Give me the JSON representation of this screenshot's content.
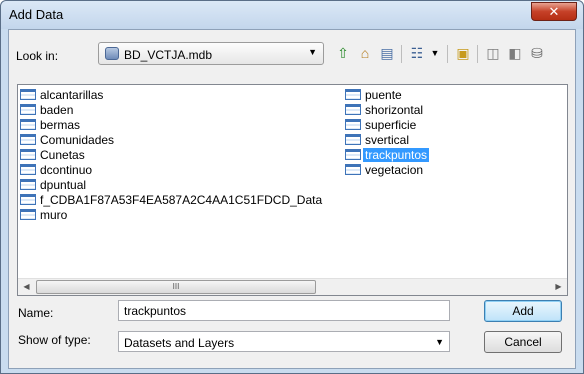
{
  "window": {
    "title": "Add Data",
    "close_glyph": "✕"
  },
  "lookin": {
    "label": "Look in:",
    "value": "BD_VCTJA.mdb",
    "icon": "database-icon"
  },
  "toolbar": {
    "icons": [
      "up-one-level-icon",
      "home-icon",
      "connect-folder-icon",
      "list-view-icon",
      "new-folder-icon",
      "catalog-icon",
      "toggle-contents-icon",
      "connect-database-icon"
    ]
  },
  "files": {
    "column1": [
      "alcantarillas",
      "baden",
      "bermas",
      "Comunidades",
      "Cunetas",
      "dcontinuo",
      "dpuntual",
      "f_CDBA1F87A53F4EA587A2C4AA1C51FDCD_Data",
      "muro"
    ],
    "column2": [
      "puente",
      "shorizontal",
      "superficie",
      "svertical",
      "trackpuntos",
      "vegetacion"
    ],
    "selected": "trackpuntos",
    "scroll_thumb_glyph": "III"
  },
  "name": {
    "label": "Name:",
    "value": "trackpuntos"
  },
  "type": {
    "label": "Show of type:",
    "value": "Datasets and Layers"
  },
  "buttons": {
    "add": "Add",
    "cancel": "Cancel"
  }
}
